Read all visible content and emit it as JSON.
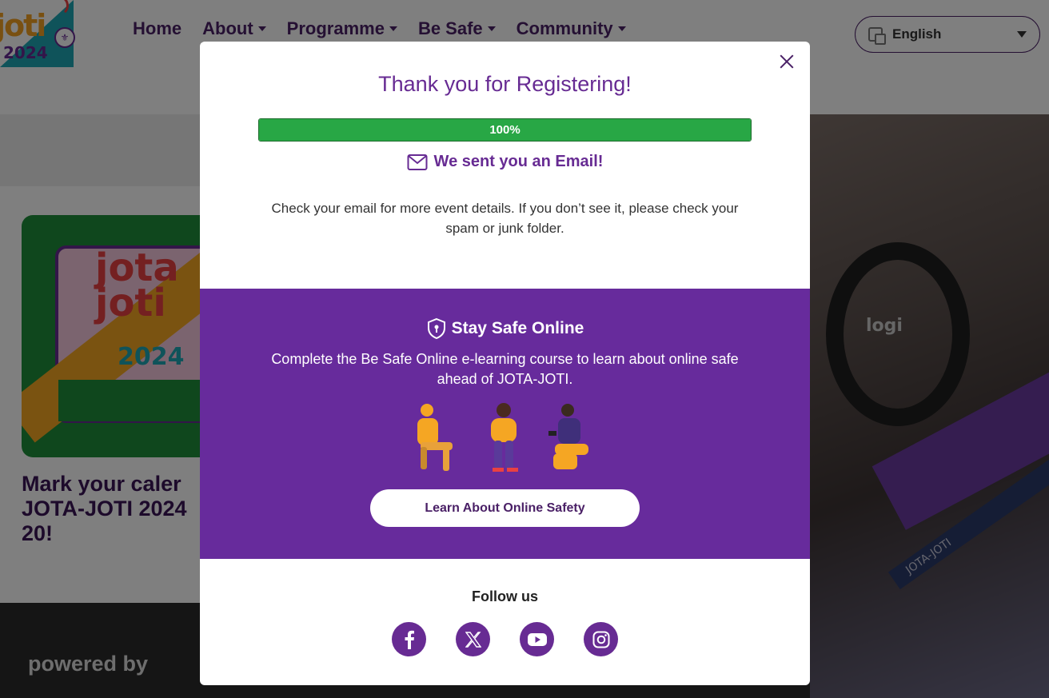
{
  "nav": {
    "logo_text": "joti",
    "logo_year": "2024",
    "items": [
      {
        "label": "Home",
        "dropdown": false
      },
      {
        "label": "About",
        "dropdown": true
      },
      {
        "label": "Programme",
        "dropdown": true
      },
      {
        "label": "Be Safe",
        "dropdown": true
      },
      {
        "label": "Community",
        "dropdown": true
      }
    ],
    "language": {
      "selected": "English",
      "icon": "translate-icon"
    }
  },
  "background": {
    "card_image": {
      "line1": "jota",
      "line2": "joti",
      "year": "2024"
    },
    "card_title_lines": [
      "Mark your caler",
      "JOTA-JOTI 2024",
      "20!"
    ],
    "photo_logo": "logi",
    "photo_strap": "JOTA-JOTI",
    "powered_by": "powered by"
  },
  "modal": {
    "title": "Thank you for Registering!",
    "progress": {
      "value": 100,
      "label": "100%",
      "color": "#28a745"
    },
    "email_heading": "We sent you an Email!",
    "email_icon": "envelope-icon",
    "body": "Check your email for more event details. If you don’t see it, please check your spam or junk folder.",
    "safe": {
      "icon": "shield-lock-icon",
      "title": "Stay Safe Online",
      "text": "Complete the Be Safe Online e-learning course to learn about online safe ahead of JOTA-JOTI.",
      "button": "Learn About Online Safety"
    },
    "follow": {
      "title": "Follow us",
      "networks": [
        {
          "name": "Facebook",
          "icon": "facebook-icon"
        },
        {
          "name": "X",
          "icon": "x-icon"
        },
        {
          "name": "YouTube",
          "icon": "youtube-icon"
        },
        {
          "name": "Instagram",
          "icon": "instagram-icon"
        }
      ]
    }
  },
  "colors": {
    "brand_purple": "#672b93",
    "safe_band": "#672b9c",
    "progress_green": "#28a745",
    "overlay": "rgba(0,0,0,0.5)"
  }
}
